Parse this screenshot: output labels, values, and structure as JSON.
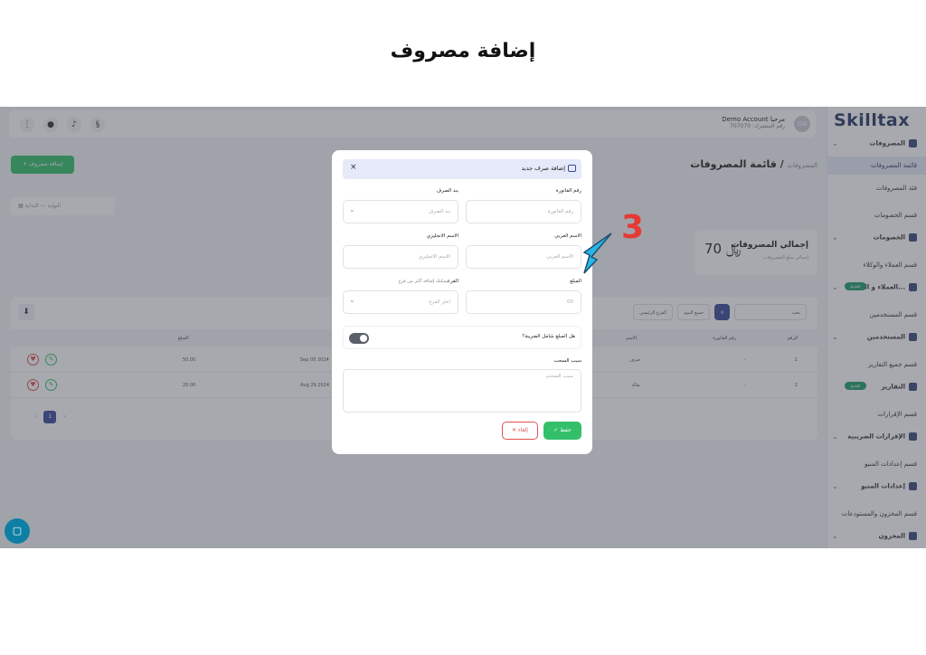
{
  "page_heading": "إضافة مصروف",
  "step_number": "3",
  "app": {
    "logo": "Skilltax",
    "account": {
      "name": "Demo Account مرحبا",
      "subtitle": "رقم المشترك: 707070",
      "initials": "DA"
    },
    "add_button": "+ إضافة مصروف",
    "breadcrumb": {
      "current": "قائمة المصروفات",
      "parent": "المصروفات"
    },
    "date_range": {
      "start": "البداية",
      "separator": "—",
      "end": "النهاية"
    },
    "total_card": {
      "title": "إجمالي المصروفات",
      "subtitle": "إجمالي مبلغ المصروفات",
      "value": "70",
      "currency": "﷼"
    },
    "sidebar": [
      {
        "label": "المصروفات",
        "main": true
      },
      {
        "label": "قائمة المصروفات",
        "active": true
      },
      {
        "label": "فئة المصروفات"
      },
      {
        "label": "قسم الخصومات"
      },
      {
        "label": "الخصومات",
        "main": true
      },
      {
        "label": "قسم العملاء والوكلاء"
      },
      {
        "label": "العملاء و الـ...",
        "main": true,
        "badge": "جديد"
      },
      {
        "label": "قسم المستخدمين"
      },
      {
        "label": "المستخدمين",
        "main": true
      },
      {
        "label": "قسم جميع التقارير"
      },
      {
        "label": "التقارير",
        "main": true,
        "badge": "جديد"
      },
      {
        "label": "قسم الإقرارات"
      },
      {
        "label": "الإقرارات الضريبية",
        "main": true
      },
      {
        "label": "قسم إعدادات المنيو"
      },
      {
        "label": "إعدادات المنيو",
        "main": true
      },
      {
        "label": "قسم المخزون والمستودعات"
      },
      {
        "label": "المخزون",
        "main": true
      }
    ],
    "filters": {
      "search": "بحث",
      "items": "جميع البنود",
      "branch": "الفرع الرئيسي"
    },
    "table": {
      "headers": {
        "number": "الرقم",
        "invoice": "رقم الفاتورة",
        "name": "الاسم",
        "date": "",
        "amount": "المبلغ"
      },
      "rows": [
        {
          "number": "1",
          "invoice": "-",
          "name": "صرف",
          "date": "Sep 05 2024",
          "amount": "50.00"
        },
        {
          "number": "2",
          "invoice": "-",
          "name": "بقالة",
          "date": "Aug 29 2024",
          "amount": "20.00"
        }
      ]
    },
    "pager": {
      "current": "1",
      "prev": "‹",
      "next": "›"
    }
  },
  "modal": {
    "title": "إضافة صرف جديد",
    "close": "×",
    "fields": {
      "invoice_number": {
        "label": "رقم الفاتورة",
        "placeholder": "رقم الفاتورة"
      },
      "expense_item": {
        "label": "بند الصرف",
        "placeholder": "بند الصرف"
      },
      "arabic_name": {
        "label": "الاسم العربي",
        "placeholder": "الاسم العربي"
      },
      "english_name": {
        "label": "الاسم الانجليزي",
        "placeholder": "الاسم الانجليزي"
      },
      "amount": {
        "label": "المبلغ",
        "placeholder": "00"
      },
      "branch": {
        "label": "الفرع",
        "hint": "يمكنك إضافة أكثر من فرع",
        "placeholder": "اختر الفرع"
      },
      "tax_included": {
        "label": "هل المبلغ شامل الضريبة؟",
        "value": true
      },
      "reason": {
        "label": "سبب السحب",
        "placeholder": "سبب السحب"
      }
    },
    "save_label": "✓ حفظ",
    "cancel_label": "✕ إلغاء"
  }
}
